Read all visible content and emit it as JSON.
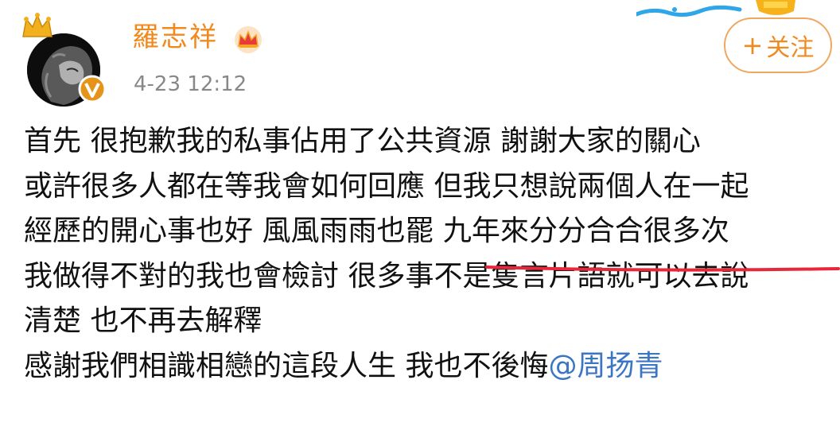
{
  "post": {
    "author": {
      "name": "羅志祥",
      "avatar_icon": "lion-avatar",
      "badges": [
        "crown-icon",
        "verified-v-icon",
        "vip-crown-icon"
      ]
    },
    "timestamp": "4-23 12:12",
    "follow_button": {
      "plus": "+",
      "label": "关注"
    },
    "lines": [
      "首先 很抱歉我的私事佔用了公共資源 謝謝大家的關心",
      "或許很多人都在等我會如何回應 但我只想說兩個人在一起",
      "經歷的開心事也好 風風雨雨也罷 九年來分分合合很多次",
      "我做得不對的我也會檢討 很多事不是隻言片語就可以去說",
      "清楚 也不再去解釋"
    ],
    "last_line": {
      "text": "感謝我們相識相戀的這段人生 我也不後悔",
      "mention": "@周扬青"
    },
    "colors": {
      "accent": "#f08a1e",
      "mention": "#3a76c4",
      "underline": "#e8283a",
      "timestamp": "#888888"
    }
  }
}
